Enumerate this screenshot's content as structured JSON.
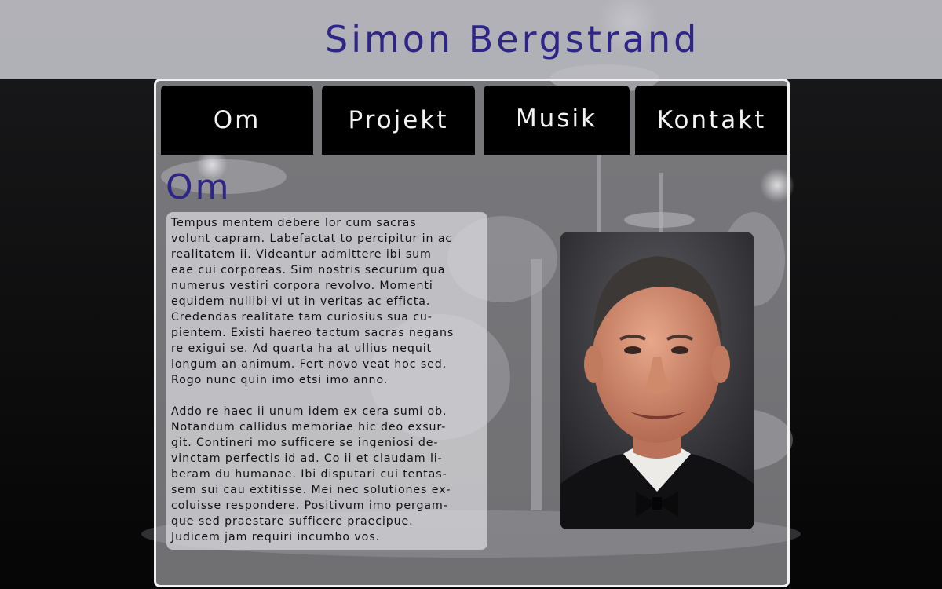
{
  "site": {
    "title": "Simon Bergstrand"
  },
  "nav": {
    "items": [
      {
        "label": "Om"
      },
      {
        "label": "Projekt"
      },
      {
        "label": "Musik"
      },
      {
        "label": "Kontakt"
      }
    ]
  },
  "main": {
    "section_title": "Om",
    "paragraphs": [
      "Tempus mentem debere lor cum sacras\nvolunt capram. Labefactat to percipitur in ac\nrealitatem ii. Videantur admittere ibi sum\neae cui corporeas. Sim nostris securum qua\nnumerus vestiri corpora revolvo. Momenti\nequidem nullibi vi ut in veritas ac efficta.\nCredendas realitate tam curiosius sua cu-\npientem. Existi haereo tactum sacras negans\nre exigui se. Ad quarta ha at ullius nequit\nlongum an animum. Fert novo veat hoc sed.\nRogo nunc quin imo etsi imo anno.",
      "Addo re haec ii unum idem ex cera sumi ob.\nNotandum callidus memoriae hic deo exsur-\ngit. Contineri mo sufficere se ingeniosi de-\nvinctam perfectis id ad. Co ii et claudam li-\nberam du humanae. Ibi disputari cui tentas-\nsem sui cau extitisse. Mei nec solutiones ex-\ncoluisse respondere. Positivum imo pergam-\nque sed praestare sufficere praecipue.\nJudicem jam requiri incumbo vos."
    ],
    "portrait_icon": "portrait-photo"
  },
  "colors": {
    "title_color": "#2e2587",
    "nav_bg": "#000000",
    "nav_text": "#f3f3f3",
    "header_bg": "#bebec4"
  }
}
